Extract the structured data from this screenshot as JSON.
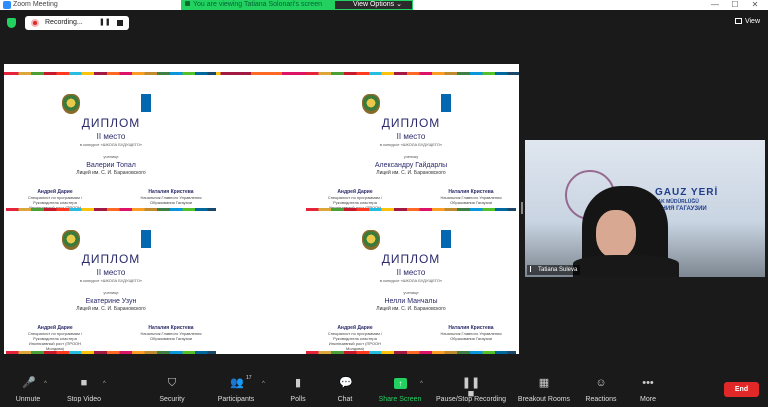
{
  "window": {
    "title": "Zoom Meeting",
    "minimize": "—",
    "maximize": "☐",
    "close": "✕"
  },
  "share_banner": {
    "text": "You are viewing Tatiana Solonari's screen",
    "view_options": "View Options",
    "view_options_caret": "⌄"
  },
  "topbar": {
    "recording": "Recording...",
    "pause_glyph": "❚❚",
    "view": "View"
  },
  "diplomas": [
    {
      "title": "ДИПЛОМ",
      "place": "II место",
      "contest": "в конкурсе «ШКОЛА БУДУЩЕГО»",
      "role": "ученице",
      "name": "Валерии Топал",
      "school": "Лицей им. С. И. Барановского",
      "sig_left_name": "Андрей Дарие",
      "sig_left_text": "Специалист по программам / Руководитель кластера Инклюзивный рост (ПРООН Молдова)",
      "sig_right_name": "Наталия Кристева",
      "sig_right_text": "Начальник Главного Управления Образования Гагаузии"
    },
    {
      "title": "ДИПЛОМ",
      "place": "II место",
      "contest": "в конкурсе «ШКОЛА БУДУЩЕГО»",
      "role": "ученику",
      "name": "Александру Гайдарлы",
      "school": "Лицей им. С. И. Барановского",
      "sig_left_name": "Андрей Дарие",
      "sig_left_text": "Специалист по программам / Руководитель кластера Инклюзивный рост (ПРООН Молдова)",
      "sig_right_name": "Наталия Кристева",
      "sig_right_text": "Начальник Главного Управления Образования Гагаузии"
    },
    {
      "title": "ДИПЛОМ",
      "place": "II место",
      "contest": "в конкурсе «ШКОЛА БУДУЩЕГО»",
      "role": "ученице",
      "name": "Екатерине Узун",
      "school": "Лицей им. С. И. Барановского",
      "sig_left_name": "Андрей Дарие",
      "sig_left_text": "Специалист по программам / Руководитель кластера Инклюзивный рост (ПРООН Молдова)",
      "sig_right_name": "Наталия Кристева",
      "sig_right_text": "Начальник Главного Управления Образования Гагаузии"
    },
    {
      "title": "ДИПЛОМ",
      "place": "II место",
      "contest": "в конкурсе «ШКОЛА БУДУЩЕГО»",
      "role": "ученице",
      "name": "Нелли Манчалы",
      "school": "Лицей им. С. И. Барановского",
      "sig_left_name": "Андрей Дарие",
      "sig_left_text": "Специалист по программам / Руководитель кластера Инклюзивный рост (ПРООН Молдова)",
      "sig_right_name": "Наталия Кристева",
      "sig_right_text": "Начальник Главного Управления Образования Гагаузии"
    }
  ],
  "video": {
    "participant": "Tatiana Suleva",
    "bg_title": "GAUZ YERİ",
    "bg_sub1": "ERETMAK MÜDÜRLÜĞÜ",
    "bg_sub2": "ОБРАЗОВАНИЯ ГАГАУЗИИ"
  },
  "toolbar": {
    "unmute": "Unmute",
    "stop_video": "Stop Video",
    "security": "Security",
    "participants": "Participants",
    "participants_count": "17",
    "polls": "Polls",
    "chat": "Chat",
    "share_screen": "Share Screen",
    "pause_stop_recording": "Pause/Stop Recording",
    "breakout_rooms": "Breakout Rooms",
    "reactions": "Reactions",
    "more": "More",
    "end": "End",
    "caret": "^"
  },
  "colors": {
    "accent_green": "#23d160",
    "end_red": "#e02828",
    "background": "#1a1a1a"
  },
  "icons": [
    "zoom-app-icon",
    "shield-icon",
    "record-icon",
    "pause-icon",
    "stop-icon",
    "grid-icon",
    "mic-muted-icon",
    "camera-icon",
    "shield-security-icon",
    "people-icon",
    "bar-chart-icon",
    "chat-bubble-icon",
    "share-arrow-icon",
    "pause-stop-icon",
    "breakout-grid-icon",
    "smiley-icon",
    "ellipsis-icon"
  ]
}
